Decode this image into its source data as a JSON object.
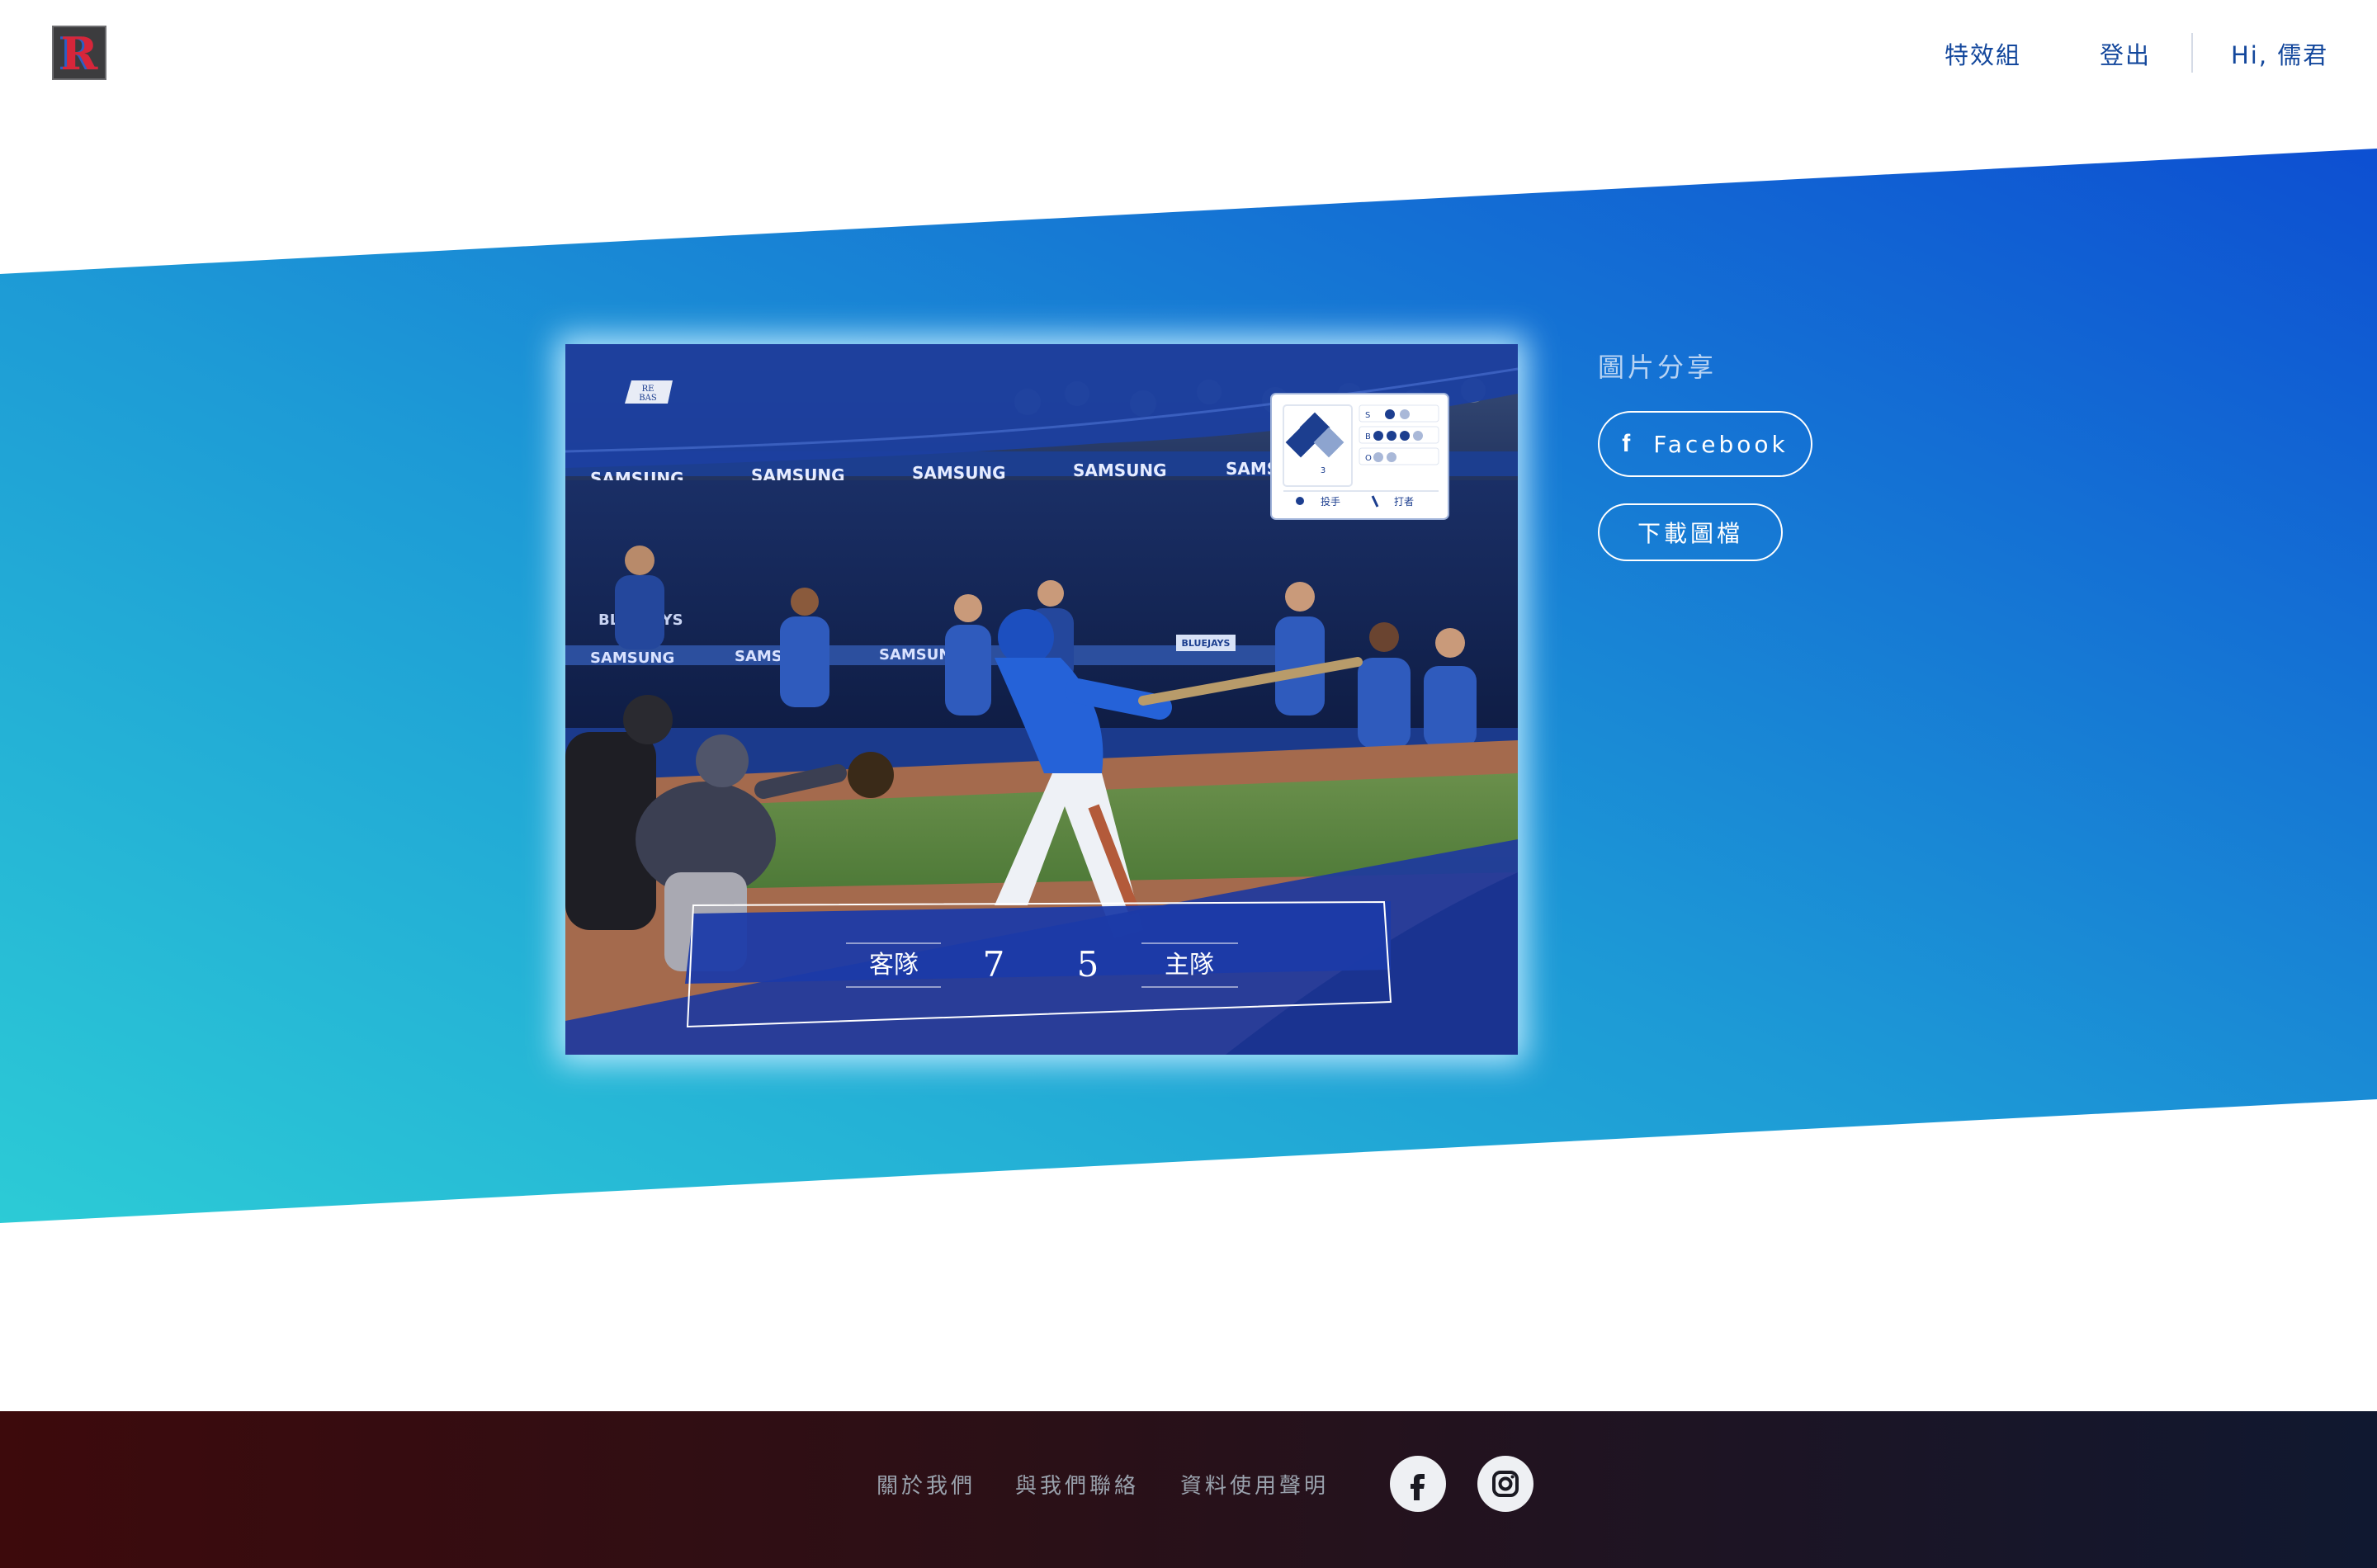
{
  "header": {
    "logo_text": "R",
    "nav": [
      "特效組",
      "登出",
      "Hi, 儒君"
    ]
  },
  "hero": {
    "gradient": [
      "#2ccbd6",
      "#1d9ad6",
      "#0d4fd2"
    ],
    "photo": {
      "badge": [
        "RE",
        "BAS"
      ],
      "ad_text": "SAMSUNG",
      "sign_text": "BLUEJAYS",
      "dugout_text": "BLUE JAYS",
      "count": {
        "strike_label": "S",
        "ball_label": "B",
        "out_label": "O",
        "strikes": 1,
        "balls": 3,
        "outs": 0
      },
      "base_number": "3",
      "legend": {
        "pitcher": "投手",
        "batter": "打者"
      },
      "scoreboard": {
        "away_label": "客隊",
        "away_score": "7",
        "home_score": "5",
        "home_label": "主隊"
      }
    }
  },
  "share": {
    "title": "圖片分享",
    "facebook_label": "Facebook",
    "download_label": "下載圖檔"
  },
  "footer": {
    "links": [
      "關於我們",
      "與我們聯絡",
      "資料使用聲明"
    ]
  }
}
